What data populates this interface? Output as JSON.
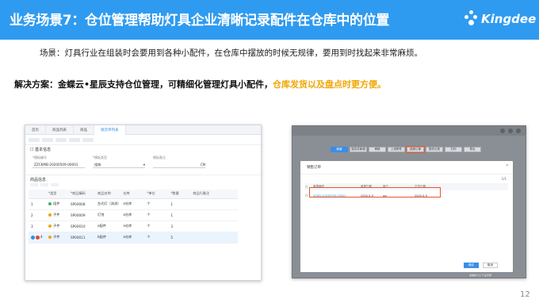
{
  "header": {
    "title": "业务场景7：仓位管理帮助灯具企业清晰记录配件在仓库中的位置",
    "logo_text": "Kingdee"
  },
  "scenario": "场景：灯具行业在组装时会要用到各种小配件，在仓库中摆放的时候无规律，要用到时找起来非常麻烦。",
  "solution": {
    "prefix": "解决方案：金蝶云•星辰支持仓位管理，可精细化管理灯具小配件，",
    "highlight": "仓库发货以及盘点时更方便。"
  },
  "shot1": {
    "tabs": [
      "首页",
      "商品列表",
      "商品",
      "锁货单列表"
    ],
    "section_basic": "基本信息",
    "fields": [
      {
        "label": "*模板编号",
        "value": "ZZCKMB-20200509-00001"
      },
      {
        "label": "*模板类型",
        "value": "组装"
      },
      {
        "label": "模板备注",
        "value": "CN"
      }
    ],
    "section_goods": "商品信息",
    "columns": [
      "",
      "*类型",
      "*商品编码",
      "商品名称",
      "仓库",
      "*单位",
      "*数量",
      "商品行备注"
    ],
    "rows": [
      {
        "no": "1",
        "type": "组件",
        "code": "SP00008",
        "name": "台式灯（流流）",
        "wh": "a仓库",
        "unit": "个",
        "qty": "1"
      },
      {
        "no": "2",
        "type": "子件",
        "code": "SP00009",
        "name": "灯泡",
        "wh": "a仓库",
        "unit": "个",
        "qty": "1"
      },
      {
        "no": "3",
        "type": "子件",
        "code": "SP00010",
        "name": "a配件",
        "wh": "a仓库",
        "unit": "个",
        "qty": "3"
      },
      {
        "no": "4",
        "type": "子件",
        "code": "SP00011",
        "name": "b配件",
        "wh": "a仓库",
        "unit": "个",
        "qty": "5"
      }
    ]
  },
  "shot2": {
    "buttons": [
      "新增",
      "保存并新增",
      "审核",
      "上传附件",
      "选择订单",
      "操作记录",
      "打印",
      "导出"
    ],
    "highlight_button": "选择订单",
    "dialog_title": "销售订单",
    "pager": "1/1",
    "dialog_columns": [
      "单据编号",
      "单据日期",
      "客户",
      "交货日期"
    ],
    "dialog_row": {
      "code": "XSDD-20200509-00001",
      "date": "2020-5-9",
      "customer": "wu",
      "delivery": "2020-5-9"
    },
    "ok": "确定",
    "cancel": "取消",
    "footer": "金蝶精斗云 产品手册"
  },
  "page_number": "12",
  "colors": {
    "header_bg": "#2f9bf0",
    "highlight": "#f0a500",
    "red_box": "#e8552a"
  }
}
